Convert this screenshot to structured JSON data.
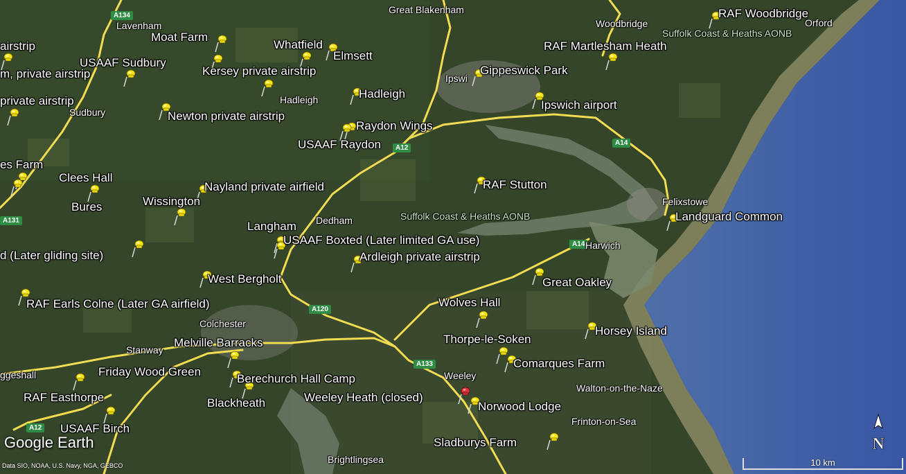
{
  "map": {
    "provider_logo": "Google Earth",
    "attribution": "Data SIO, NOAA, U.S. Navy, NGA, GEBCO",
    "compass_letter": "N",
    "scale_label": "10 km"
  },
  "placemarks": {
    "raf_woodbridge": "RAF Woodbridge",
    "moat_farm": "Moat Farm",
    "whatfield": "Whatfield",
    "elmsett": "Elmsett",
    "raf_martlesham_heath": "RAF Martlesham Heath",
    "usaaf_sudbury": "USAAF Sudbury",
    "private_airstrip_top": "airstrip",
    "private_airstrip_2": "m, private airstrip",
    "kersey": "Kersey private airstrip",
    "gippeswick_park": "Gippeswick Park",
    "private_airstrip_3": "private airstrip",
    "hadleigh_pin": "Hadleigh",
    "ipswich_airport": "Ipswich airport",
    "newton": "Newton private airstrip",
    "raydon_wings": "Raydon Wings",
    "usaaf_raydon": "USAAF Raydon",
    "clees_farm": "es Farm",
    "clees_hall": "Clees Hall",
    "raf_stutton": "RAF Stutton",
    "nayland": "Nayland private airfield",
    "bures": "Bures",
    "wissington": "Wissington",
    "landguard_common": "Landguard Common",
    "langham": "Langham",
    "usaaf_boxted": "USAAF Boxted  (Later limited GA use)",
    "later_gliding": "d (Later gliding site)",
    "ardleigh": "Ardleigh private airstrip",
    "west_bergholt": "West Bergholt",
    "great_oakley": "Great Oakley",
    "raf_earls_colne": "RAF Earls Colne (Later GA airfield)",
    "wolves_hall": "Wolves Hall",
    "horsey_island": "Horsey Island",
    "melville_barracks": "Melville Barracks",
    "thorpe_le_soken": "Thorpe-le-Soken",
    "comarques_farm": "Comarques Farm",
    "friday_wood_green": "Friday Wood Green",
    "berechurch_hall_camp": "Berechurch Hall Camp",
    "raf_easthorpe": "RAF Easthorpe",
    "blackheath": "Blackheath",
    "weeley_heath": "Weeley Heath (closed)",
    "norwood_lodge": "Norwood Lodge",
    "usaaf_birch": "USAAF Birch",
    "sladburys_farm": "Sladburys Farm"
  },
  "towns": {
    "great_blakenham": "Great Blakenham",
    "lavenham": "Lavenham",
    "woodbridge": "Woodbridge",
    "orford": "Orford",
    "aonb_top": "Suffolk Coast & Heaths AONB",
    "ipswich": "Ipswi",
    "hadleigh": "Hadleigh",
    "sudbury": "Sudbury",
    "felixstowe": "Felixstowe",
    "dedham": "Dedham",
    "aonb_mid": "Suffolk Coast & Heaths AONB",
    "harwich": "Harwich",
    "colchester": "Colchester",
    "stanway": "Stanway",
    "weeley": "Weeley",
    "walton": "Walton-on-the-Naze",
    "frinton": "Frinton-on-Sea",
    "brightlingsea": "Brightlingsea",
    "coggeshall": "ggeshall"
  },
  "roads": {
    "a134": "A134",
    "a12_top": "A12",
    "a14_right": "A14",
    "a131": "A131",
    "a120": "A120",
    "a14_harwich": "A14",
    "a133": "A133",
    "a12_bottom": "A12"
  },
  "colors": {
    "sea": "#3f5fa6",
    "land": "#394a2c",
    "road": "#f1dc52",
    "pin_yellow": "#f6e51b",
    "pin_red": "#e0343c"
  }
}
